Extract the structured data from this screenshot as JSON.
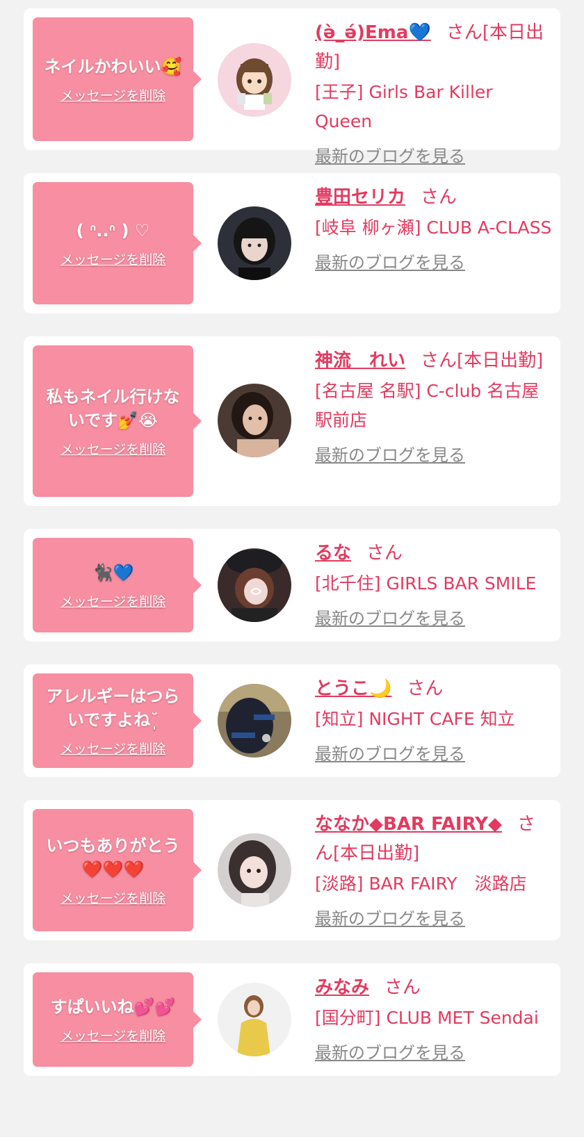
{
  "delete_label": "メッセージを削除",
  "blog_label": "最新のブログを見る",
  "colors": {
    "accent": "#e33a5f",
    "bubble": "#f78ea2",
    "background": "#f2f2f2",
    "card": "#ffffff",
    "link_gray": "#888888"
  },
  "items": [
    {
      "message": "ネイルかわいい",
      "message_emoji": "🥰",
      "name": "(ə̀_ə́)Ema",
      "name_emoji": "💙",
      "san": "さん",
      "status": "[本日出勤]",
      "shop": "[王子] Girls Bar Killer Queen"
    },
    {
      "message": "( ᐢ..ᐢ ) ♡",
      "message_emoji": "",
      "name": "豊田セリカ",
      "name_emoji": "",
      "san": "さん",
      "status": "",
      "shop": "[岐阜 柳ヶ瀬] CLUB A-CLASS"
    },
    {
      "message": "私もネイル行けないです",
      "message_emoji": "💅😭",
      "name": "神流　れい",
      "name_emoji": "",
      "san": "さん",
      "status": "[本日出勤]",
      "shop": "[名古屋 名駅] C-club 名古屋駅前店"
    },
    {
      "message": "",
      "message_emoji": "🐈‍⬛💙",
      "name": "るな",
      "name_emoji": "",
      "san": "さん",
      "status": "",
      "shop": "[北千住] GIRLS BAR SMILE"
    },
    {
      "message": "アレルギーはつらいですよね",
      "message_emoji": "˘̩̩̩",
      "name": "とうこ",
      "name_emoji": "🌙",
      "san": "さん",
      "status": "",
      "shop": "[知立] NIGHT CAFE 知立"
    },
    {
      "message": "いつもありがとう",
      "message_emoji": "❤️❤️❤️",
      "name": "ななか◆BAR FAIRY◆",
      "name_emoji": "",
      "san": "さん",
      "status": "[本日出勤]",
      "shop": "[淡路] BAR FAIRY　淡路店"
    },
    {
      "message": "すぱいいね",
      "message_emoji": "💕💕",
      "name": "みなみ",
      "name_emoji": "",
      "san": "さん",
      "status": "",
      "shop": "[国分町] CLUB MET Sendai"
    }
  ]
}
